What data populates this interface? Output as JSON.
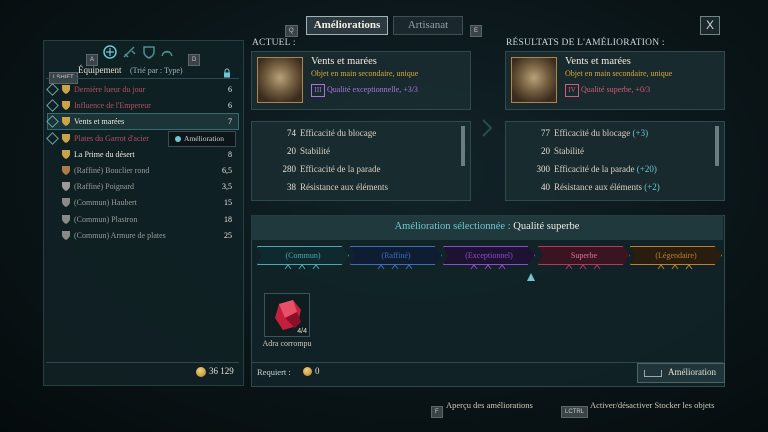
{
  "tabs": {
    "prev_key": "Q",
    "next_key": "E",
    "items": [
      {
        "label": "Améliorations",
        "active": true
      },
      {
        "label": "Artisanat",
        "active": false
      }
    ],
    "close_label": "X"
  },
  "inventory": {
    "filter_keys": {
      "left": "A",
      "right": "D"
    },
    "shift_key": "LSHIFT",
    "title": "Équipement",
    "sort": "(Trié par : Type)",
    "tooltip": "Amélioration",
    "items": [
      {
        "name": "Dernière lueur du jour",
        "count": "6",
        "style": "red",
        "icon_color": "#c9a44a",
        "marker": true
      },
      {
        "name": "Influence de l'Empereur",
        "count": "6",
        "style": "red",
        "icon_color": "#c9a44a",
        "marker": true
      },
      {
        "name": "Vents et marées",
        "count": "7",
        "style": "white",
        "icon_color": "#c9a44a",
        "marker": true,
        "selected": true
      },
      {
        "name": "Plates du Garrot d'acier",
        "count": "",
        "style": "red",
        "icon_color": "#c9a44a",
        "marker": true
      },
      {
        "name": "La Prime du désert",
        "count": "8",
        "style": "white",
        "icon_color": "#c9a44a",
        "marker": false
      },
      {
        "name": "(Raffiné) Bouclier rond",
        "count": "6,5",
        "style": "gray",
        "icon_color": "#b07a46",
        "marker": false
      },
      {
        "name": "(Raffiné) Poignard",
        "count": "3,5",
        "style": "gray",
        "icon_color": "#9b9b9b",
        "marker": false
      },
      {
        "name": "(Commun) Haubert",
        "count": "15",
        "style": "gray",
        "icon_color": "#8a8a8a",
        "marker": false
      },
      {
        "name": "(Commun) Plastron",
        "count": "18",
        "style": "gray",
        "icon_color": "#8a8a8a",
        "marker": false
      },
      {
        "name": "(Commun) Armure de plates",
        "count": "25",
        "style": "gray",
        "icon_color": "#8a8a8a",
        "marker": false
      }
    ],
    "currency": "36 129"
  },
  "current": {
    "header": "ACTUEL :",
    "name": "Vents et marées",
    "subtitle": "Objet en main secondaire, unique",
    "quality_numeral": "III",
    "quality": "Qualité exceptionnelle, +3/3",
    "stats": [
      {
        "value": "74",
        "label": "Efficacité du blocage",
        "bonus": ""
      },
      {
        "value": "20",
        "label": "Stabilité",
        "bonus": ""
      },
      {
        "value": "280",
        "label": "Efficacité de la parade",
        "bonus": ""
      },
      {
        "value": "38",
        "label": "Résistance aux éléments",
        "bonus": ""
      }
    ]
  },
  "result": {
    "header": "RÉSULTATS DE L'AMÉLIORATION :",
    "name": "Vents et marées",
    "subtitle": "Objet en main secondaire, unique",
    "quality_numeral": "IV",
    "quality": "Qualité superbe, +0/3",
    "stats": [
      {
        "value": "77",
        "label": "Efficacité du blocage",
        "bonus": "(+3)"
      },
      {
        "value": "20",
        "label": "Stabilité",
        "bonus": ""
      },
      {
        "value": "300",
        "label": "Efficacité de la parade",
        "bonus": "(+20)"
      },
      {
        "value": "40",
        "label": "Résistance aux éléments",
        "bonus": "(+2)"
      }
    ]
  },
  "upgrade": {
    "selected_label": "Amélioration sélectionnée :",
    "selected_value": "Qualité superbe",
    "tiers": [
      {
        "label": "(Commun)",
        "color": "#4fa7b0",
        "fill": "#0f2a2e"
      },
      {
        "label": "(Raffiné)",
        "color": "#3c6fb8",
        "fill": "#0f1d33"
      },
      {
        "label": "(Exceptionnel)",
        "color": "#8a4fc6",
        "fill": "#1e1233"
      },
      {
        "label": "Superbe",
        "color": "#b23a5a",
        "fill": "#3a1420"
      },
      {
        "label": "(Légendaire)",
        "color": "#b8822f",
        "fill": "#2a1c0e"
      }
    ],
    "material_name": "Adra corrompu",
    "material_count": "4/4",
    "requires_label": "Requiert :",
    "requires_value": "0",
    "button_label": "Amélioration"
  },
  "footer": {
    "preview_key": "F",
    "preview_label": "Aperçu des améliorations",
    "stash_key": "LCTRL",
    "stash_label": "Activer/désactiver Stocker les objets"
  },
  "colors": {
    "accent_teal": "#6ec7d0",
    "quality_purple": "#a774e0",
    "quality_red": "#d45a78",
    "gold": "#d7a93c"
  }
}
